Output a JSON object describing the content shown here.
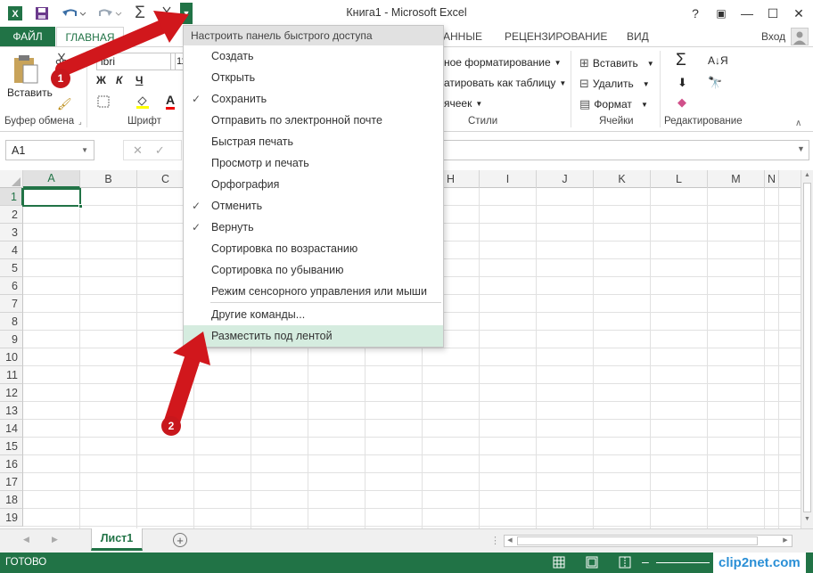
{
  "title": "Книга1 - Microsoft Excel",
  "user": "Вход",
  "window_buttons": [
    "?",
    "▣",
    "—",
    "☐",
    "✕"
  ],
  "tabs": {
    "file": "ФАЙЛ",
    "home": "ГЛАВНАЯ",
    "partial_data": "АННЫЕ",
    "review": "РЕЦЕНЗИРОВАНИЕ",
    "view": "ВИД"
  },
  "ribbon": {
    "paste": "Вставить",
    "clipboard_label": "Буфер обмена",
    "font_label": "Шрифт",
    "font_name_partial": "ibri",
    "font_size_partial": "11",
    "bold": "Ж",
    "italic": "К",
    "underline": "Ч",
    "cond_format_partial": "ное форматирование",
    "format_table_partial": "атировать как таблицу",
    "cell_styles_partial": "ячеек",
    "styles_label": "Стили",
    "insert": "Вставить",
    "delete": "Удалить",
    "format": "Формат",
    "cells_label": "Ячейки",
    "editing_label": "Редактирование"
  },
  "formula_bar": {
    "name_box": "A1"
  },
  "grid": {
    "columns": [
      "A",
      "B",
      "C",
      "D",
      "E",
      "F",
      "G",
      "H",
      "I",
      "J",
      "K",
      "L",
      "M",
      "N"
    ],
    "rows": [
      "1",
      "2",
      "3",
      "4",
      "5",
      "6",
      "7",
      "8",
      "9",
      "10",
      "11",
      "12",
      "13",
      "14",
      "15",
      "16",
      "17",
      "18",
      "19"
    ]
  },
  "sheet_tab": "Лист1",
  "status": "ГОТОВО",
  "watermark": "clip2net.com",
  "menu": {
    "header": "Настроить панель быстрого доступа",
    "items": [
      {
        "label": "Создать",
        "checked": false
      },
      {
        "label": "Открыть",
        "checked": false
      },
      {
        "label": "Сохранить",
        "checked": true
      },
      {
        "label": "Отправить по электронной почте",
        "checked": false
      },
      {
        "label": "Быстрая печать",
        "checked": false
      },
      {
        "label": "Просмотр и печать",
        "checked": false
      },
      {
        "label": "Орфография",
        "checked": false
      },
      {
        "label": "Отменить",
        "checked": true
      },
      {
        "label": "Вернуть",
        "checked": true
      },
      {
        "label": "Сортировка по возрастанию",
        "checked": false
      },
      {
        "label": "Сортировка по убыванию",
        "checked": false
      },
      {
        "label": "Режим сенсорного управления или мыши",
        "checked": false
      }
    ],
    "more_commands": "Другие команды...",
    "below_ribbon": "Разместить под лентой"
  },
  "annotations": {
    "badge1": "1",
    "badge2": "2"
  },
  "colors": {
    "excel_green": "#217346",
    "arrow_red": "#d1171c",
    "menu_highlight": "#d5ecdf"
  }
}
